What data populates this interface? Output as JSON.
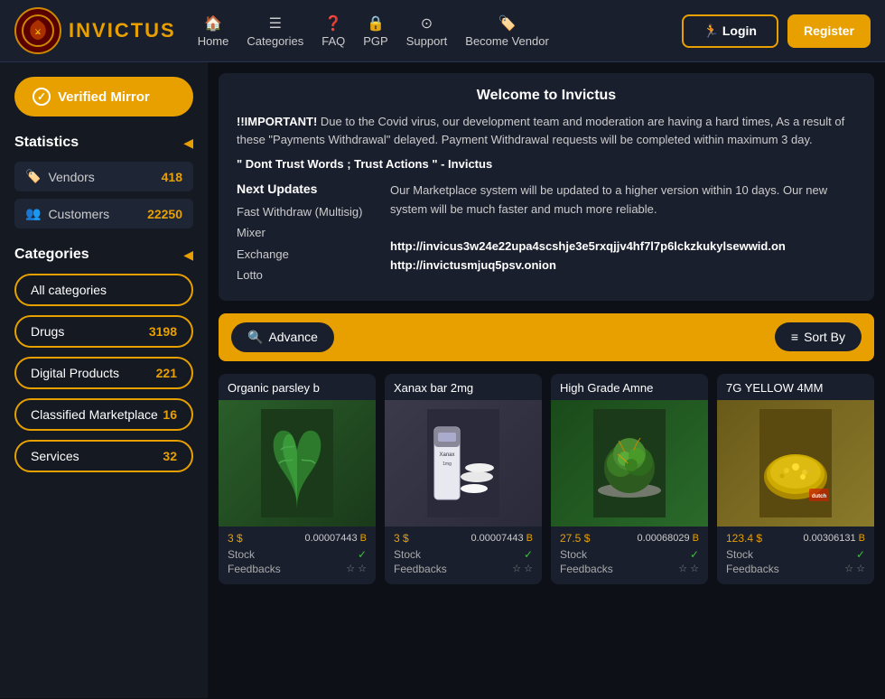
{
  "header": {
    "logo_text_before": "IN",
    "logo_text_highlight": "V",
    "logo_text_after": "ICTUS",
    "nav": [
      {
        "id": "home",
        "icon": "🏠",
        "label": "Home"
      },
      {
        "id": "categories",
        "icon": "≡",
        "label": "Categories"
      },
      {
        "id": "faq",
        "icon": "?",
        "label": "FAQ"
      },
      {
        "id": "pgp",
        "icon": "🔒",
        "label": "PGP"
      },
      {
        "id": "support",
        "icon": "⊙",
        "label": "Support"
      },
      {
        "id": "become_vendor",
        "icon": "🏷",
        "label": "Become Vendor"
      }
    ],
    "login_label": "Login",
    "register_label": "Register"
  },
  "sidebar": {
    "verified_mirror_label": "Verified Mirror",
    "statistics": {
      "title": "Statistics",
      "items": [
        {
          "id": "vendors",
          "icon": "🏷",
          "label": "Vendors",
          "value": "418"
        },
        {
          "id": "customers",
          "icon": "👥",
          "label": "Customers",
          "value": "22250"
        }
      ]
    },
    "categories": {
      "title": "Categories",
      "items": [
        {
          "id": "all",
          "label": "All categories",
          "count": ""
        },
        {
          "id": "drugs",
          "label": "Drugs",
          "count": "3198"
        },
        {
          "id": "digital",
          "label": "Digital Products",
          "count": "221"
        },
        {
          "id": "classified",
          "label": "Classified Marketplace",
          "count": "16"
        },
        {
          "id": "services",
          "label": "Services",
          "count": "32"
        }
      ]
    }
  },
  "welcome": {
    "title": "Welcome to Invictus",
    "important_label": "!!IMPORTANT!",
    "important_text": " Due to the Covid virus, our development team and moderation are having a hard times, As a result of these \"Payments Withdrawal\" delayed. Payment Withdrawal requests will be completed within maximum 3 day.",
    "quote": "\" Dont Trust Words ; Trust Actions \" - Invictus",
    "updates_title": "Next Updates",
    "updates_items": [
      "Fast Withdraw (Multisig)",
      "Mixer",
      "Exchange",
      "Lotto"
    ],
    "updates_description": "Our Marketplace system will be updated to a higher version within 10 days. Our new system will be much faster and much more reliable.",
    "link1": "http://invicus3w24e22upa4scshje3e5rxqjjv4hf7l7p6lckzkukylsewwid.on",
    "link2": "http://invictusmjuq5psv.onion"
  },
  "search_bar": {
    "advance_label": "Advance",
    "sort_label": "Sort By"
  },
  "products": [
    {
      "id": "p1",
      "title": "Organic parsley b",
      "price_usd": "3",
      "price_btc": "0.00007443",
      "stock": true,
      "feedbacks": "☆ ☆",
      "img_type": "parsley",
      "emoji": "🌿"
    },
    {
      "id": "p2",
      "title": "Xanax bar 2mg",
      "price_usd": "3",
      "price_btc": "0.00007443",
      "stock": true,
      "feedbacks": "☆ ☆",
      "img_type": "xanax",
      "emoji": "💊"
    },
    {
      "id": "p3",
      "title": "High Grade Amne",
      "price_usd": "27.5",
      "price_btc": "0.00068029",
      "stock": true,
      "feedbacks": "☆ ☆",
      "img_type": "weed",
      "emoji": "🌱"
    },
    {
      "id": "p4",
      "title": "7G YELLOW 4MM",
      "price_usd": "123.4",
      "price_btc": "0.00306131",
      "stock": true,
      "feedbacks": "☆ ☆",
      "img_type": "yellow",
      "emoji": "🟡"
    }
  ],
  "labels": {
    "stock": "Stock",
    "feedbacks": "Feedbacks",
    "check_mark": "✓",
    "dollar": "$",
    "btc_symbol": "B"
  }
}
